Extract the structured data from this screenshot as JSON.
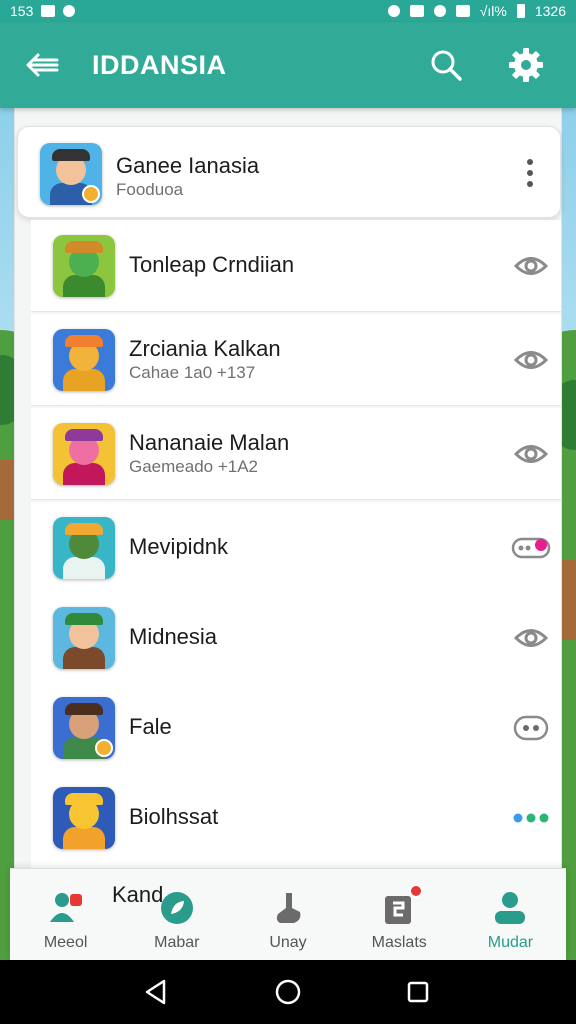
{
  "status_bar": {
    "time": "153",
    "clock": "1326",
    "battery": "√ıl%"
  },
  "app_bar": {
    "title": "IDDANSIA"
  },
  "list": [
    {
      "title": "Ganee Ianasia",
      "subtitle": "Fooduoa",
      "action": "more-vert",
      "highlight": true
    },
    {
      "title": "Tonleap Crndiian",
      "subtitle": "",
      "action": "eye"
    },
    {
      "title": "Zrciania Kalkan",
      "subtitle": "Cahae 1a0 +137",
      "action": "eye"
    },
    {
      "title": "Nananaie Malan",
      "subtitle": "Gaemeado +1A2",
      "action": "eye"
    },
    {
      "title": "Mevipidnk",
      "subtitle": "",
      "action": "toggle"
    },
    {
      "title": "Midnesia",
      "subtitle": "",
      "action": "eye"
    },
    {
      "title": "Fale",
      "subtitle": "",
      "action": "chat"
    },
    {
      "title": "Biolhssat",
      "subtitle": "",
      "action": "dots"
    }
  ],
  "peek_item": {
    "title": "Kand"
  },
  "bottom_nav": [
    {
      "label": "Meeol",
      "icon": "people-icon"
    },
    {
      "label": "Mabar",
      "icon": "leaf-icon"
    },
    {
      "label": "Unay",
      "icon": "hand-icon"
    },
    {
      "label": "Maslats",
      "icon": "notes-icon"
    },
    {
      "label": "Mudar",
      "icon": "person-icon"
    }
  ],
  "colors": {
    "primary": "#31ab98",
    "active": "#2a9c8c",
    "eye": "#8a8a8a"
  }
}
